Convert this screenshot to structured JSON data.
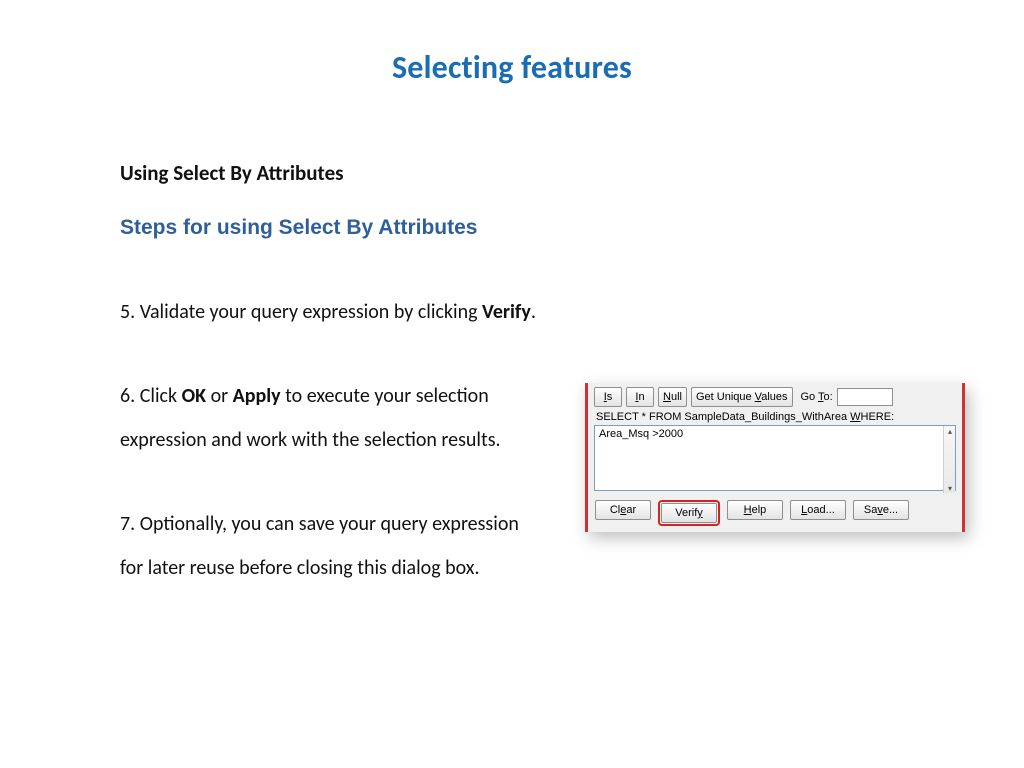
{
  "page": {
    "title": "Selecting features"
  },
  "content": {
    "section_heading": "Using Select By Attributes",
    "sub_heading": "Steps for using Select By Attributes",
    "step5_pre": "5. Validate your query expression by clicking ",
    "step5_bold": "Verify",
    "step5_post": ".",
    "step6_pre": "6. Click ",
    "step6_bold1": "OK",
    "step6_mid": " or ",
    "step6_bold2": "Apply",
    "step6_post": " to execute your selection expression and work with the selection results.",
    "step7": "7. Optionally, you can save your query expression for later reuse before closing this dialog box."
  },
  "dialog": {
    "buttons_top": {
      "is_u": "I",
      "is_rest": "s",
      "in_u": "I",
      "in_rest": "n",
      "null_u": "N",
      "null_rest": "ull",
      "unique_pre": "Get Unique ",
      "unique_u": "V",
      "unique_post": "alues",
      "goto_label_pre": "Go ",
      "goto_label_u": "T",
      "goto_label_post": "o:"
    },
    "sql_pre": "SELECT * FROM SampleData_Buildings_WithArea ",
    "sql_u": "W",
    "sql_post": "HERE:",
    "query_value": "Area_Msq >2000",
    "buttons_bottom": {
      "clear_pre": "Cl",
      "clear_u": "e",
      "clear_post": "ar",
      "verify_pre": "Verif",
      "verify_u": "y",
      "help_u": "H",
      "help_post": "elp",
      "load_u": "L",
      "load_post": "oad...",
      "save_u": "S",
      "save_pre": "",
      "save_mid": "a",
      "save_post": "ve...",
      "save_u2": "v"
    }
  }
}
